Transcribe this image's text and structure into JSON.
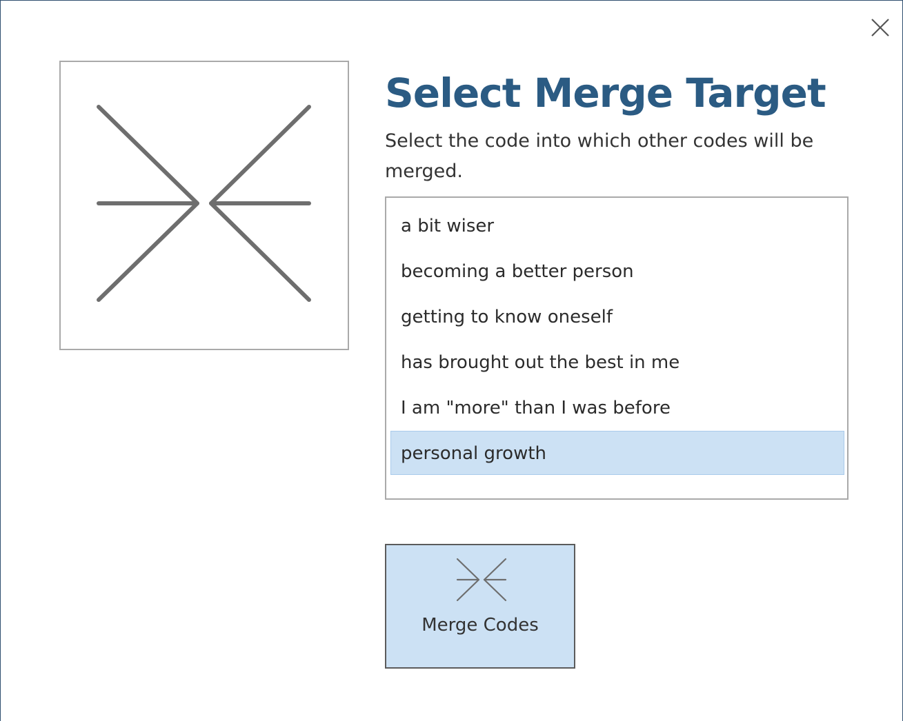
{
  "dialog": {
    "title": "Select Merge Target",
    "subtitle": "Select the code into which other codes will be merged.",
    "close_icon": "close-icon",
    "illustration_icon": "merge-arrows-icon"
  },
  "codes": {
    "items": [
      {
        "label": "a bit wiser",
        "selected": false
      },
      {
        "label": "becoming a better person",
        "selected": false
      },
      {
        "label": "getting to know oneself",
        "selected": false
      },
      {
        "label": "has brought out the best in me",
        "selected": false
      },
      {
        "label": "I am \"more\" than I was before",
        "selected": false
      },
      {
        "label": "personal growth",
        "selected": true
      }
    ]
  },
  "merge_button": {
    "label": "Merge Codes",
    "icon": "merge-arrows-icon"
  },
  "colors": {
    "title": "#2b5b83",
    "selection": "#cce1f4",
    "button_bg": "#cce1f4",
    "border": "#a9a9a9",
    "icon_stroke": "#6e6e6e"
  }
}
